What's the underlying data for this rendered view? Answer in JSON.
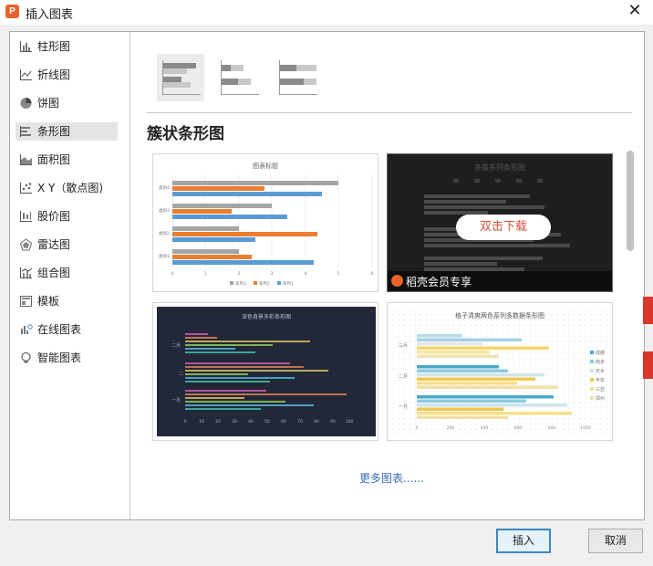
{
  "window": {
    "title": "插入图表",
    "app_icon_letter": "P"
  },
  "sidebar": {
    "items": [
      {
        "label": "柱形图",
        "icon": "column-chart-icon"
      },
      {
        "label": "折线图",
        "icon": "line-chart-icon"
      },
      {
        "label": "饼图",
        "icon": "pie-chart-icon"
      },
      {
        "label": "条形图",
        "icon": "bar-chart-icon",
        "active": true
      },
      {
        "label": "面积图",
        "icon": "area-chart-icon"
      },
      {
        "label": "X Y（散点图)",
        "icon": "scatter-chart-icon"
      },
      {
        "label": "股价图",
        "icon": "stock-chart-icon"
      },
      {
        "label": "雷达图",
        "icon": "radar-chart-icon"
      },
      {
        "label": "组合图",
        "icon": "combo-chart-icon"
      },
      {
        "label": "模板",
        "icon": "template-icon"
      },
      {
        "label": "在线图表",
        "icon": "online-chart-icon"
      },
      {
        "label": "智能图表",
        "icon": "smart-chart-icon"
      }
    ]
  },
  "subtypes": [
    "clustered-bar",
    "stacked-bar",
    "percent-stacked-bar"
  ],
  "main": {
    "heading": "簇状条形图",
    "more_link": "更多图表......",
    "download_button": "双击下载",
    "member_label": "稻壳会员专享"
  },
  "templates": [
    {
      "title": "图表标题",
      "theme": "light",
      "categories": [
        "类别4",
        "类别3",
        "类别2",
        "类别1"
      ],
      "legend": [
        "系列3",
        "系列2",
        "系列1"
      ],
      "ticks": [
        "0",
        "1",
        "2",
        "3",
        "4",
        "5",
        "6"
      ]
    },
    {
      "title": "多篮系列条形图",
      "theme": "dark"
    },
    {
      "title": "深色背景多彩条形图",
      "theme": "navy",
      "categories": [
        "二月",
        "二",
        "一月"
      ],
      "ticks": [
        "0",
        "10",
        "20",
        "30",
        "40",
        "50",
        "60",
        "70",
        "80",
        "90",
        "100"
      ]
    },
    {
      "title": "格子清爽两色系列多数据条形图",
      "theme": "grid",
      "categories": [
        "三月",
        "二月",
        "一月"
      ],
      "legend": [
        "成都",
        "南京",
        "天水",
        "丰泉",
        "三亚",
        "郑州"
      ],
      "ticks": [
        "0",
        "200",
        "400",
        "600",
        "800",
        "1000"
      ]
    }
  ],
  "buttons": {
    "insert": "插入",
    "cancel": "取消"
  },
  "colors": {
    "accent": "#3c86c7",
    "orange": "#ed7d31",
    "blue": "#5b9bd5",
    "gray": "#a5a5a5",
    "brand": "#e8632a"
  }
}
